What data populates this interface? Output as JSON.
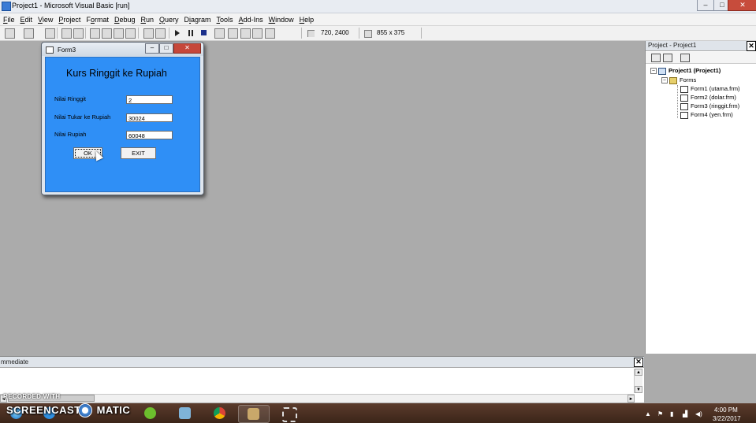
{
  "window": {
    "title": "Project1 - Microsoft Visual Basic [run]",
    "min": "–",
    "max": "□",
    "close": "✕"
  },
  "menu": [
    "File",
    "Edit",
    "View",
    "Project",
    "Format",
    "Debug",
    "Run",
    "Query",
    "Diagram",
    "Tools",
    "Add-Ins",
    "Window",
    "Help"
  ],
  "menu_underline": [
    "F",
    "E",
    "V",
    "P",
    "o",
    "D",
    "R",
    "Q",
    "i",
    "T",
    "A",
    "W",
    "H"
  ],
  "toolbar": {
    "position": "720, 2400",
    "size": "855 x 375"
  },
  "form": {
    "title": "Form3",
    "min": "–",
    "max": "□",
    "close": "✕",
    "heading": "Kurs Ringgit ke Rupiah",
    "labels": {
      "ringgit": "Nilai Ringgit",
      "tukar": "Nilai Tukar ke Rupiah",
      "rupiah": "Nilai Rupiah"
    },
    "values": {
      "ringgit": "2",
      "tukar": "30024",
      "rupiah": "60048"
    },
    "ok_label": "OK",
    "exit_label": "EXIT"
  },
  "project": {
    "header": "Project - Project1",
    "close": "✕",
    "root": "Project1 (Project1)",
    "folder": "Forms",
    "items": [
      "Form1 (utama.frm)",
      "Form2 (dolar.frm)",
      "Form3 (ringgit.frm)",
      "Form4 (yen.frm)"
    ]
  },
  "immediate": {
    "header": "mmediate",
    "close": "✕"
  },
  "watermark": {
    "line1": "RECORDED WITH",
    "line2": "SCREENCAST",
    "line3": "MATIC"
  },
  "taskbar": {
    "time": "4:00 PM",
    "date": "3/22/2017"
  },
  "colors": {
    "form_client": "#2f8ff6",
    "design_area": "#ababab",
    "taskbar": "#4a2f22"
  }
}
